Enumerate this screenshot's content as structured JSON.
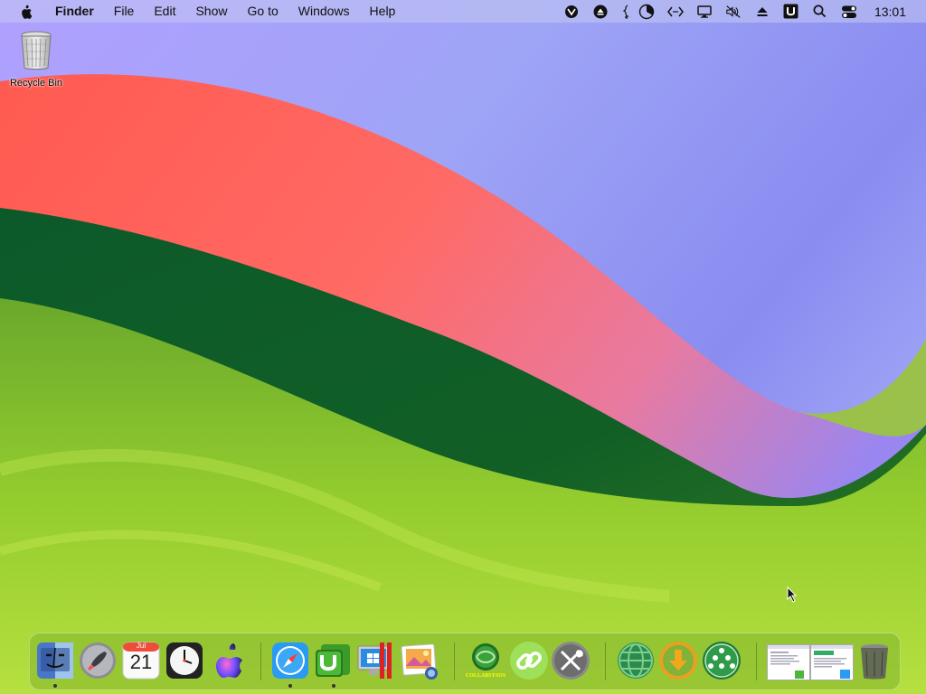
{
  "menubar": {
    "app_name": "Finder",
    "items": [
      "File",
      "Edit",
      "Show",
      "Go to",
      "Windows",
      "Help"
    ],
    "clock": "13:01",
    "status_icons": [
      "vpn-icon",
      "eject-circle-icon",
      "stats-icon",
      "pie-icon",
      "code-icon",
      "display-icon",
      "mute-icon",
      "eject-icon",
      "u-icon",
      "search-icon",
      "control-center-icon"
    ]
  },
  "desktop": {
    "recycle_bin_label": "Recycle Bin"
  },
  "dock": {
    "calendar": {
      "month": "Jul",
      "day": "21"
    },
    "collab_label": "COLLABSYSOS",
    "items": [
      "finder",
      "launchpad",
      "calendar",
      "clock",
      "siri",
      "safari",
      "utorrent",
      "bootcamp",
      "preview",
      "collabsysos",
      "link",
      "tools",
      "globe",
      "downloads",
      "network",
      "window-thumb-1",
      "window-thumb-2",
      "trash"
    ]
  },
  "colors": {
    "menubar": "#c3c8f0",
    "accent_green": "#7fbd2a",
    "accent_red": "#ff5a55",
    "accent_purple": "#9a86f0"
  }
}
